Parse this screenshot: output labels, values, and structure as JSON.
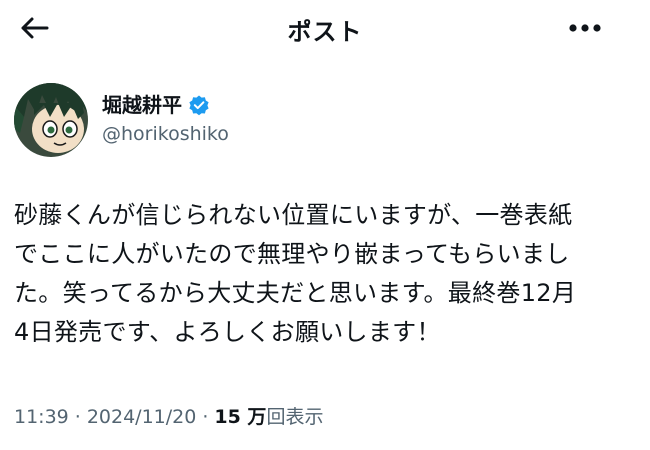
{
  "header": {
    "title": "ポスト",
    "back_icon": "arrow-left-icon",
    "more_icon": "more-horizontal-icon"
  },
  "author": {
    "display_name": "堀越耕平",
    "handle": "@horikoshiko",
    "verified": true,
    "verified_color": "#1d9bf0"
  },
  "post": {
    "lines": [
      "砂藤くんが信じられない位置にいますが、一巻表紙",
      "でここに人がいたので無理やり嵌まってもらいまし",
      "た。笑ってるから大丈夫だと思います。最終巻12月",
      "4日発売です、よろしくお願いします！"
    ]
  },
  "meta": {
    "time": "11:39",
    "separator": "·",
    "date": "2024/11/20",
    "views_count": "15 万",
    "views_label": "回表示"
  }
}
